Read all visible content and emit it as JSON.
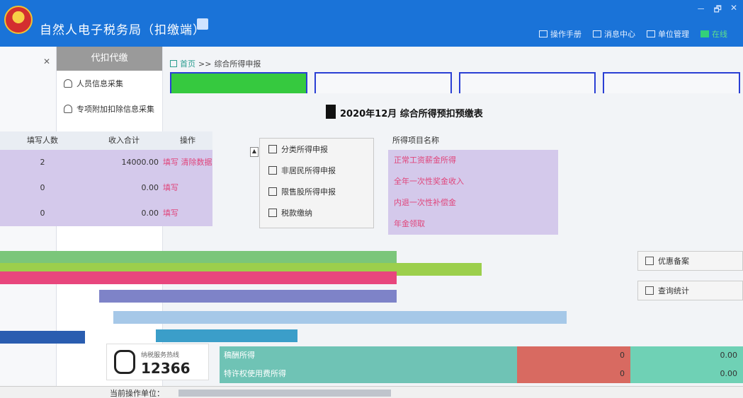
{
  "app": {
    "title": "自然人电子税务局（扣缴端）"
  },
  "window_controls": [
    "－",
    "🗗",
    "✕"
  ],
  "top_actions": [
    {
      "label": "操作手册",
      "icon": "manual-icon"
    },
    {
      "label": "消息中心",
      "icon": "message-icon"
    },
    {
      "label": "单位管理",
      "icon": "unit-icon"
    },
    {
      "label": "在线",
      "icon": "online-icon"
    }
  ],
  "subnav": {
    "header": "代扣代缴",
    "items": [
      {
        "label": "人员信息采集"
      },
      {
        "label": "专项附加扣除信息采集"
      }
    ]
  },
  "breadcrumb": {
    "home": "首页",
    "sep": ">>",
    "current": "综合所得申报"
  },
  "form_title": "2020年12月  综合所得预扣预缴表",
  "left_table": {
    "headers": [
      "填写人数",
      "收入合计",
      "操作"
    ],
    "rows": [
      {
        "count": "2",
        "income": "14000.00",
        "fill": "填写",
        "clear": "清除数据"
      },
      {
        "count": "0",
        "income": "0.00",
        "fill": "填写",
        "clear": ""
      },
      {
        "count": "0",
        "income": "0.00",
        "fill": "填写",
        "clear": ""
      }
    ]
  },
  "categories": [
    {
      "label": "分类所得申报",
      "icon": "category-icon"
    },
    {
      "label": "非居民所得申报",
      "icon": "nonresident-icon"
    },
    {
      "label": "限售股所得申报",
      "icon": "restricted-stock-icon"
    },
    {
      "label": "税款缴纳",
      "icon": "tax-payment-icon"
    }
  ],
  "income_items": {
    "header": "所得项目名称",
    "items": [
      "正常工资薪金所得",
      "全年一次性奖金收入",
      "内退一次性补偿金",
      "年金领取"
    ]
  },
  "right_actions": [
    {
      "label": "优惠备案",
      "icon": "filing-icon"
    },
    {
      "label": "查询统计",
      "icon": "query-icon"
    }
  ],
  "bottom_rows": [
    {
      "name": "稿酬所得",
      "value1": "0",
      "value2": "0.00"
    },
    {
      "name": "特许权使用费所得",
      "value1": "0",
      "value2": "0.00"
    }
  ],
  "hotline": {
    "label": "纳税服务热线",
    "number": "12366"
  },
  "status": {
    "unit_label": "当前操作单位："
  }
}
